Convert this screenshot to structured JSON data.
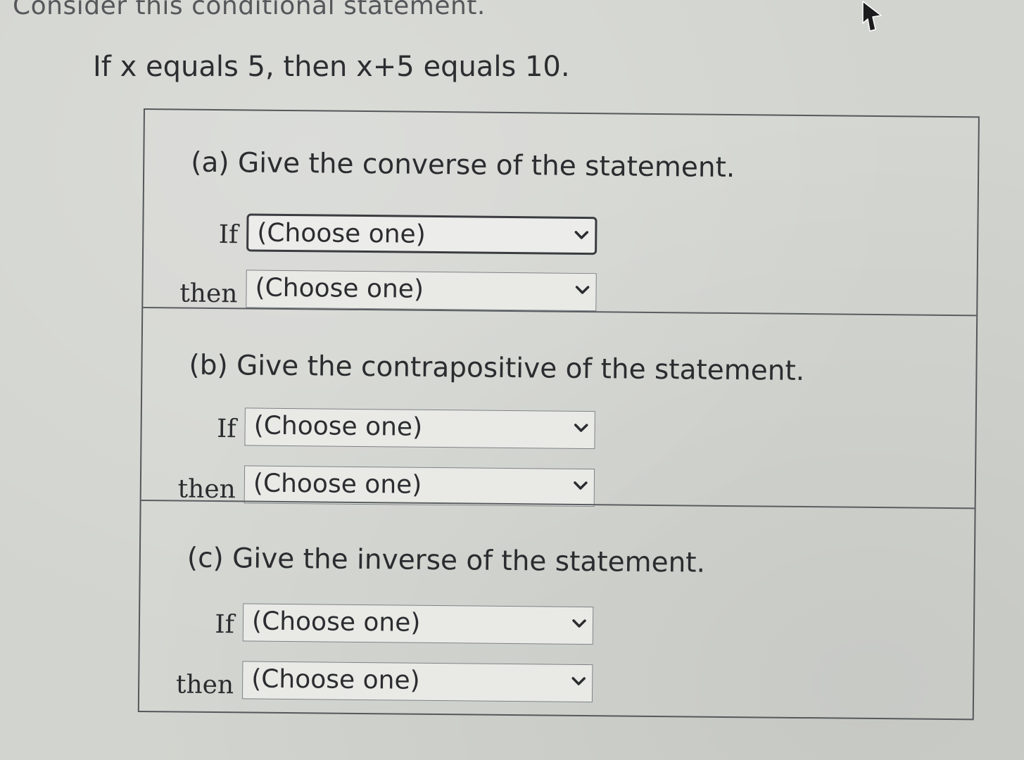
{
  "intro_text": "Consider this conditional statement.",
  "statement": "If x equals 5, then x+5 equals 10.",
  "parts": [
    {
      "heading": "(a) Give the converse of the statement.",
      "if_label": "If",
      "if_value": "(Choose one)",
      "then_label": "then",
      "then_value": "(Choose one)"
    },
    {
      "heading": "(b) Give the contrapositive of the statement.",
      "if_label": "If",
      "if_value": "(Choose one)",
      "then_label": "then",
      "then_value": "(Choose one)"
    },
    {
      "heading": "(c) Give the inverse of the statement.",
      "if_label": "If",
      "if_value": "(Choose one)",
      "then_label": "then",
      "then_value": "(Choose one)"
    }
  ],
  "icons": {
    "dropdown": "chevron-down-icon",
    "pointer": "mouse-cursor-icon"
  },
  "colors": {
    "background": "#d2d4cf",
    "text": "#2e2e30",
    "border": "#55585b"
  }
}
